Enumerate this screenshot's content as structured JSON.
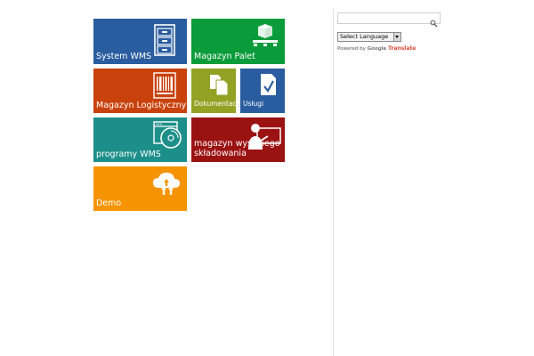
{
  "colors": {
    "blue": "#2a5d9f",
    "green": "#0a9b3a",
    "orange_red": "#c9410b",
    "olive": "#93a224",
    "teal": "#1d8f8a",
    "dark_red": "#9b1212",
    "orange": "#f59400"
  },
  "tiles": [
    {
      "label": "System WMS",
      "icon": "filing-cabinet-icon",
      "color": "#2a5d9f"
    },
    {
      "label": "Magazyn Palet",
      "icon": "pallet-boxes-icon",
      "color": "#0a9b3a"
    },
    {
      "label": "Magazyn Logistyczny",
      "icon": "barcode-icon",
      "color": "#c9410b"
    },
    {
      "label": "Dokumentacja",
      "icon": "documents-icon",
      "color": "#93a224"
    },
    {
      "label": "Usługi",
      "icon": "checklist-icon",
      "color": "#2a5d9f"
    },
    {
      "label": "programy WMS",
      "icon": "software-disc-icon",
      "color": "#1d8f8a"
    },
    {
      "label": "magazyn wysokiego składowania",
      "label_line1": "magazyn wysokiego",
      "label_line2": "składowania",
      "icon": "worker-presentation-icon",
      "color": "#9b1212"
    },
    {
      "label": "Demo",
      "icon": "cloud-upload-icon",
      "color": "#f59400"
    }
  ],
  "sidebar": {
    "search": {
      "value": "",
      "placeholder": "",
      "icon": "search-icon"
    },
    "language_select": {
      "selected": "Select Language"
    },
    "powered_by": {
      "prefix": "Powered by",
      "google": "Google",
      "translate": "Translate"
    }
  }
}
